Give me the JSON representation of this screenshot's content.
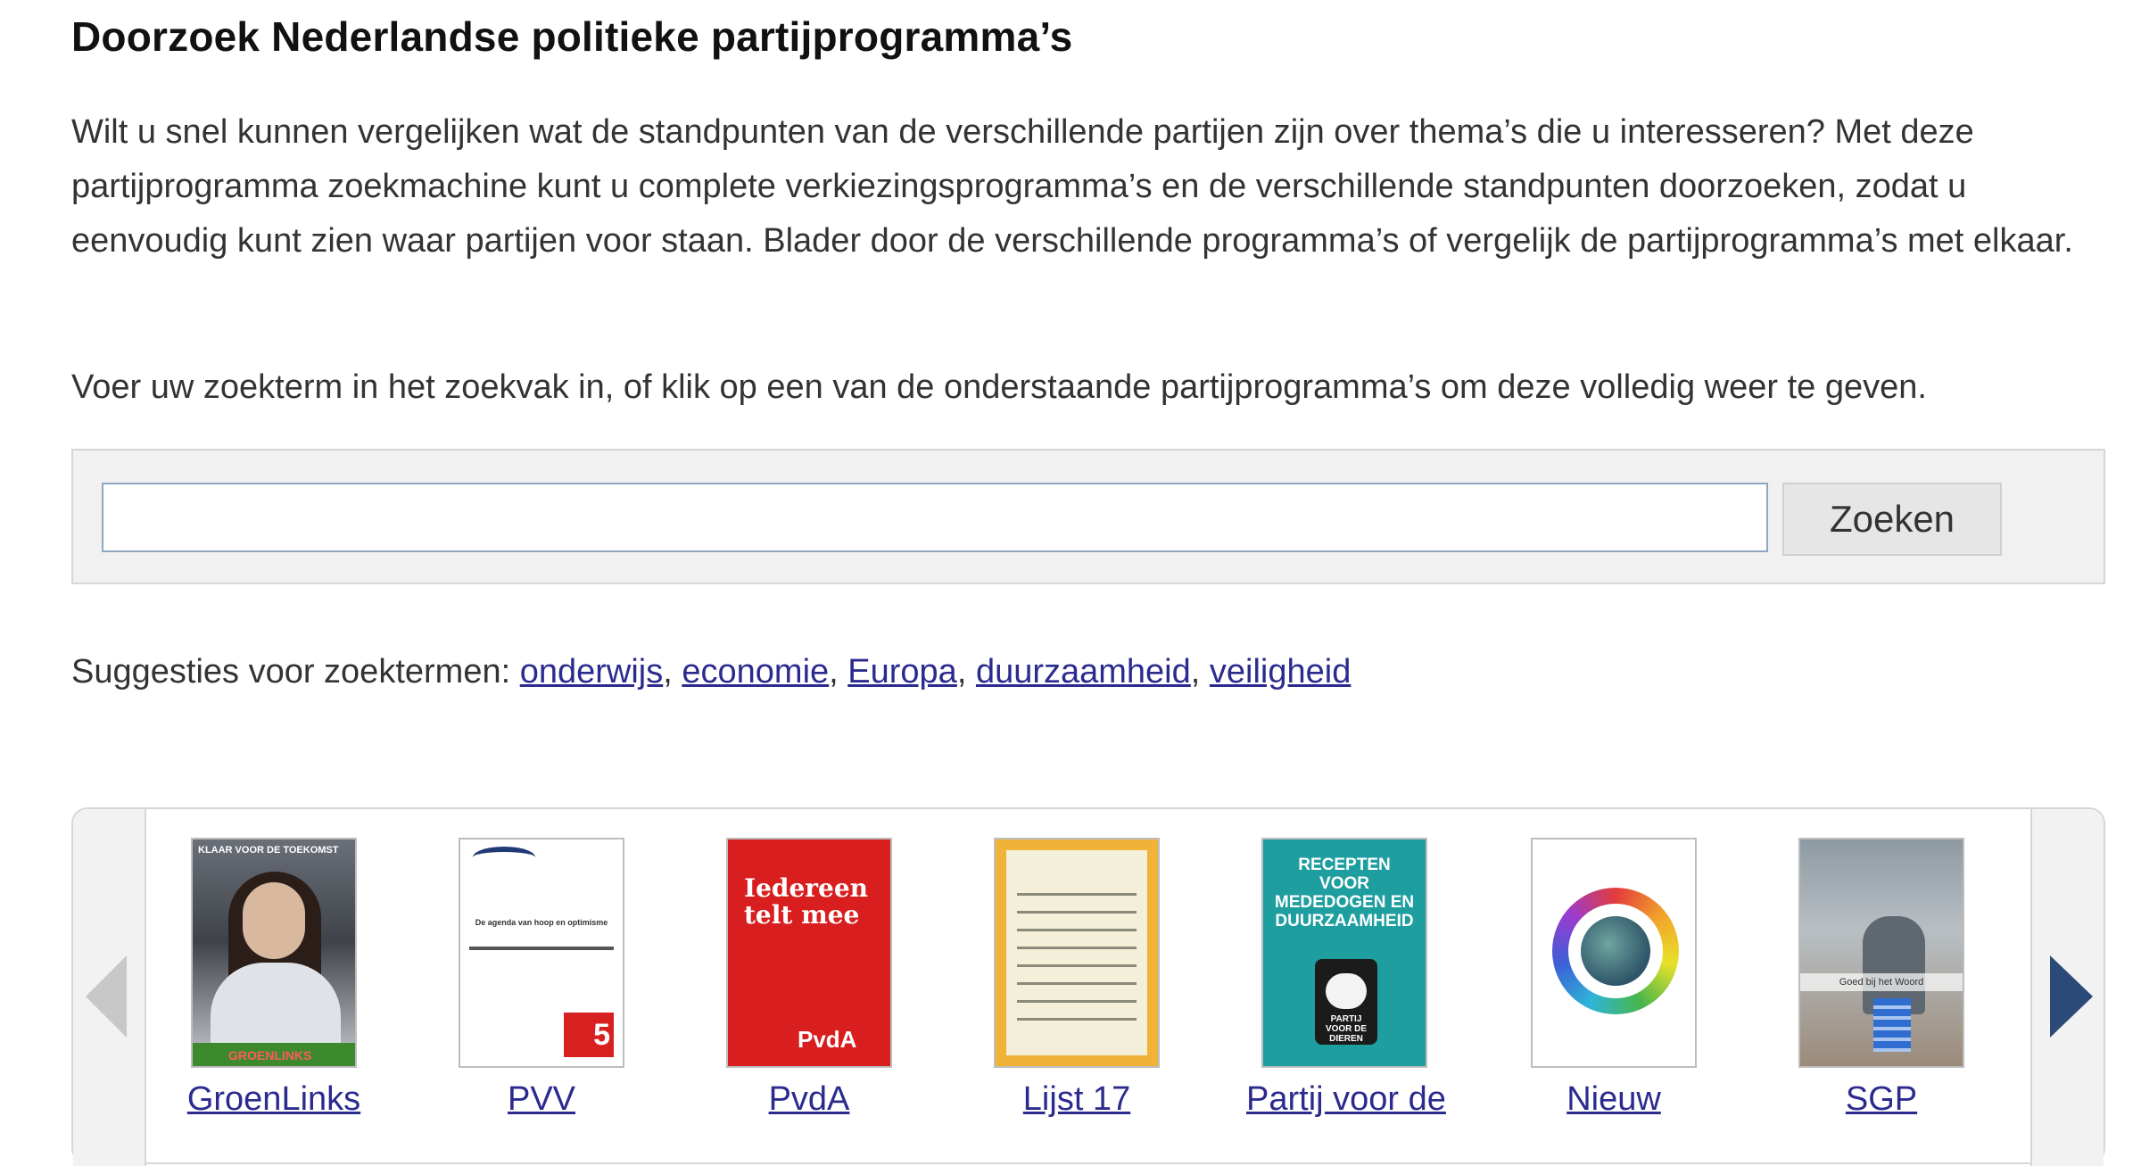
{
  "title": "Doorzoek Nederlandse politieke partijprogramma’s",
  "intro": "Wilt u snel kunnen vergelijken wat de standpunten van de verschillende partijen zijn over thema’s die u interesseren? Met deze partijprogramma zoekmachine kunt u complete verkiezingsprogramma’s en de verschillende standpunten doorzoeken, zodat u eenvoudig kunt zien waar partijen voor staan. Blader door de verschillende programma’s of vergelijk de partijprogramma’s met elkaar.",
  "instruction": "Voer uw zoekterm in het zoekvak in, of klik op een van de onderstaande partijprogramma’s om deze volledig weer te geven.",
  "search": {
    "value": "",
    "placeholder": "",
    "button_label": "Zoeken"
  },
  "suggestions": {
    "label": "Suggesties voor zoektermen:",
    "terms": [
      "onderwijs",
      "economie",
      "Europa",
      "duurzaamheid",
      "veiligheid"
    ],
    "separator": ","
  },
  "carousel": {
    "items": [
      {
        "name": "GroenLinks",
        "cover_text": "KLAAR VOOR DE TOEKOMST",
        "cover_brand": "GROENLINKS"
      },
      {
        "name": "PVV",
        "cover_text": "De agenda van hoop en optimisme",
        "cover_number": "5"
      },
      {
        "name": "PvdA",
        "cover_text": "Iedereen telt mee",
        "cover_brand": "PvdA"
      },
      {
        "name": "Lijst 17",
        "cover_text": "",
        "cover_brand": ""
      },
      {
        "name": "Partij voor de",
        "cover_text": "RECEPTEN VOOR MEDEDOGEN EN DUURZAAMHEID",
        "cover_brand": "PARTIJ VOOR DE DIEREN"
      },
      {
        "name": "Nieuw",
        "cover_text": "",
        "cover_brand": ""
      },
      {
        "name": "SGP",
        "cover_text": "Goed bij het Woord",
        "cover_brand": ""
      }
    ]
  },
  "colors": {
    "link": "#2b2b8f",
    "next_arrow": "#2c4a78",
    "prev_arrow_disabled": "#c8c8c8"
  }
}
